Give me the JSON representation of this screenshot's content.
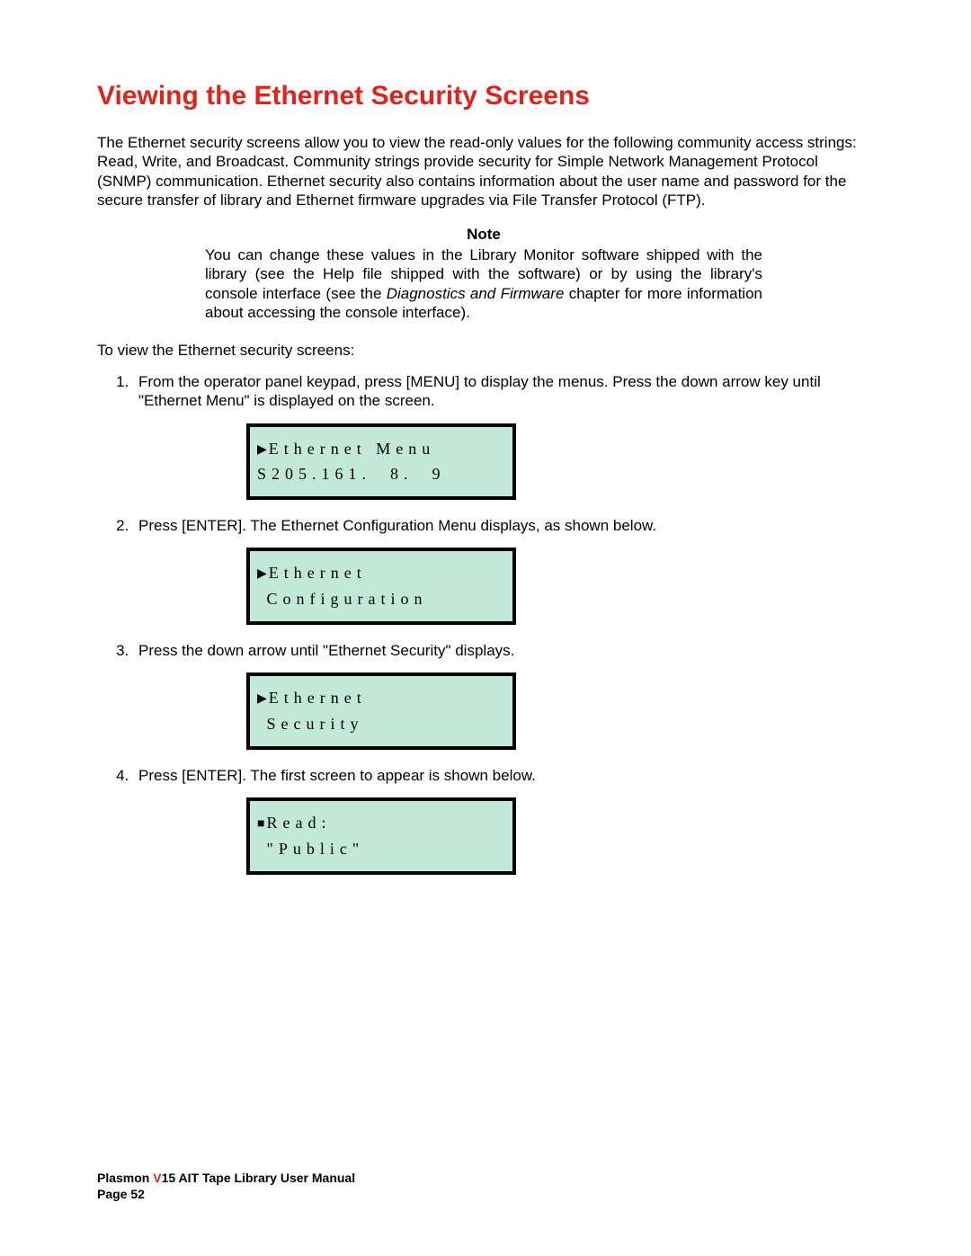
{
  "title": "Viewing the Ethernet Security Screens",
  "intro": "The Ethernet security screens allow you to view the read-only values for the following community access strings: Read, Write, and Broadcast. Community strings provide security for Simple Network Management Protocol (SNMP) communication. Ethernet security also contains information about the user name and password for the secure transfer of library and Ethernet firmware upgrades via File Transfer Protocol (FTP).",
  "note": {
    "heading": "Note",
    "text_pre": "You can change these values in the Library Monitor software shipped with the library (see the Help file shipped with the software) or by using the library's console interface (see the ",
    "text_ital": "Diagnostics and Firmware",
    "text_post": " chapter for more information about accessing the console interface)."
  },
  "lead": "To view the Ethernet security screens:",
  "steps": [
    "From the operator panel keypad, press [MENU] to display the menus. Press the down arrow key until \"Ethernet Menu\" is displayed on the screen.",
    "Press [ENTER]. The Ethernet Configuration Menu displays, as shown below.",
    "Press the down arrow until \"Ethernet Security\" displays.",
    " Press [ENTER]. The first screen to appear is shown below."
  ],
  "lcd": [
    {
      "marker": "▶",
      "line1": "Ethernet Menu",
      "line2": "S205.161.  8.  9"
    },
    {
      "marker": "▶",
      "line1": "Ethernet",
      "line2": " Configuration"
    },
    {
      "marker": "▶",
      "line1": "Ethernet",
      "line2": " Security"
    },
    {
      "marker": "■",
      "line1": "Read:",
      "line2": " \"Public\""
    }
  ],
  "footer": {
    "brand": "Plasmon ",
    "v": "V",
    "rest": "15 AIT Tape Library User Manual",
    "page": "Page 52"
  }
}
